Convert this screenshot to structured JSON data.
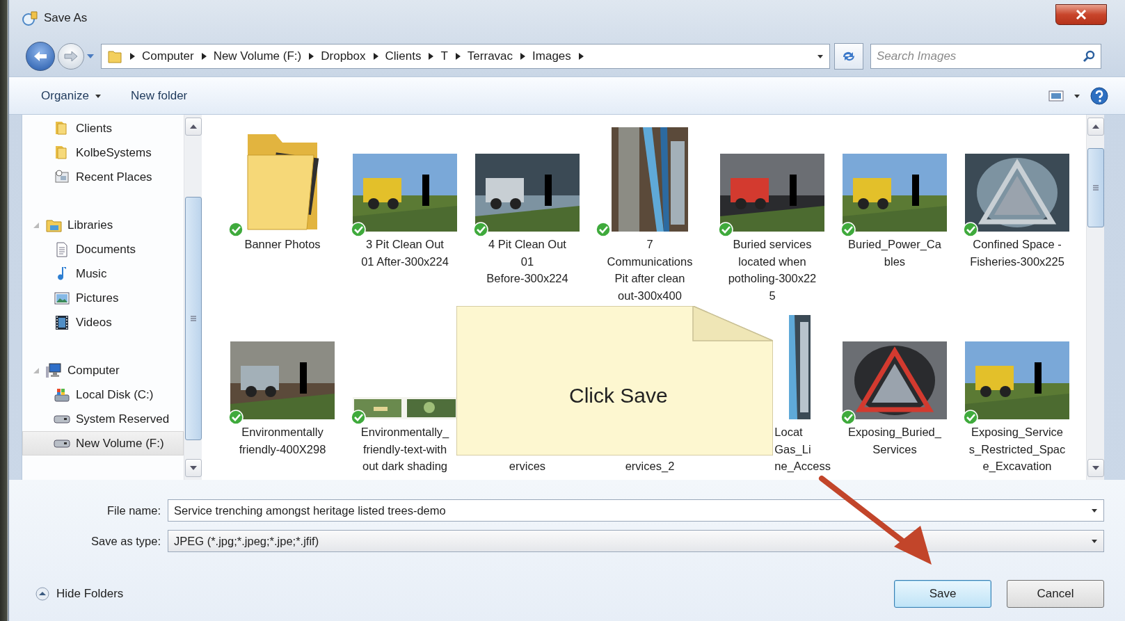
{
  "window": {
    "title": "Save As"
  },
  "address_bar": {
    "path": [
      "Computer",
      "New Volume (F:)",
      "Dropbox",
      "Clients",
      "T",
      "Terravac",
      "Images"
    ]
  },
  "search": {
    "placeholder": "Search Images"
  },
  "toolbar": {
    "buttons": [
      {
        "label": "Organize",
        "dropdown": true
      },
      {
        "label": "New folder",
        "dropdown": false
      }
    ]
  },
  "sidebar": {
    "top_items": [
      {
        "label": "Clients",
        "kind": "folder",
        "selected": false
      },
      {
        "label": "KolbeSystems",
        "kind": "folder",
        "selected": false
      },
      {
        "label": "Recent Places",
        "kind": "recent",
        "selected": false
      }
    ],
    "tree": [
      {
        "label": "Libraries",
        "kind": "library",
        "expanded": true,
        "selected": false,
        "children": [
          {
            "label": "Documents",
            "kind": "document",
            "selected": false
          },
          {
            "label": "Music",
            "kind": "music",
            "selected": false
          },
          {
            "label": "Pictures",
            "kind": "pictures",
            "selected": false
          },
          {
            "label": "Videos",
            "kind": "videos",
            "selected": false
          }
        ]
      },
      {
        "label": "Computer",
        "kind": "computer",
        "expanded": true,
        "selected": false,
        "children": [
          {
            "label": "Local Disk (C:)",
            "kind": "system-disk",
            "selected": false
          },
          {
            "label": "System Reserved",
            "kind": "drive",
            "selected": false
          },
          {
            "label": "New Volume (F:)",
            "kind": "drive",
            "selected": true
          }
        ]
      }
    ]
  },
  "files": [
    {
      "kind": "folder",
      "name": "Banner Photos",
      "synced": true
    },
    {
      "name": "3 Pit Clean Out\n01 After-300x224",
      "synced": true
    },
    {
      "name": "4 Pit Clean Out\n01\nBefore-300x224",
      "synced": true
    },
    {
      "kind": "portrait",
      "name": "7\nCommunications\nPit after clean\nout-300x400",
      "synced": true
    },
    {
      "name": "Buried services\nlocated when\npotholing-300x22\n5",
      "synced": true
    },
    {
      "name": "Buried_Power_Ca\nbles",
      "synced": true
    },
    {
      "name": "Confined Space -\nFisheries-300x225",
      "synced": true
    },
    {
      "name": "Environmentally\nfriendly-400X298",
      "synced": true
    },
    {
      "kind": "banner",
      "name": "Environmentally_\nfriendly-text-with\nout dark shading",
      "synced": true
    },
    {
      "kind": "hidden",
      "name": "ervices"
    },
    {
      "kind": "hidden",
      "name": "ervices_2"
    },
    {
      "kind": "partial",
      "name": "Locat\nGas_Li\nne_Access"
    },
    {
      "name": "Exposing_Buried_\nServices",
      "synced": true
    },
    {
      "name": "Exposing_Service\ns_Restricted_Spac\ne_Excavation",
      "synced": true
    }
  ],
  "callout": {
    "text": "Click Save"
  },
  "form": {
    "fields": [
      {
        "label": "File name:",
        "value": "Service trenching amongst heritage listed trees-demo",
        "kind": "combo"
      },
      {
        "label": "Save as type:",
        "value": "JPEG (*.jpg;*.jpeg;*.jpe;*.jfif)",
        "kind": "select"
      }
    ]
  },
  "hide_folders": {
    "label": "Hide Folders"
  },
  "buttons": [
    {
      "label": "Save",
      "default": true
    },
    {
      "label": "Cancel",
      "default": false
    }
  ]
}
